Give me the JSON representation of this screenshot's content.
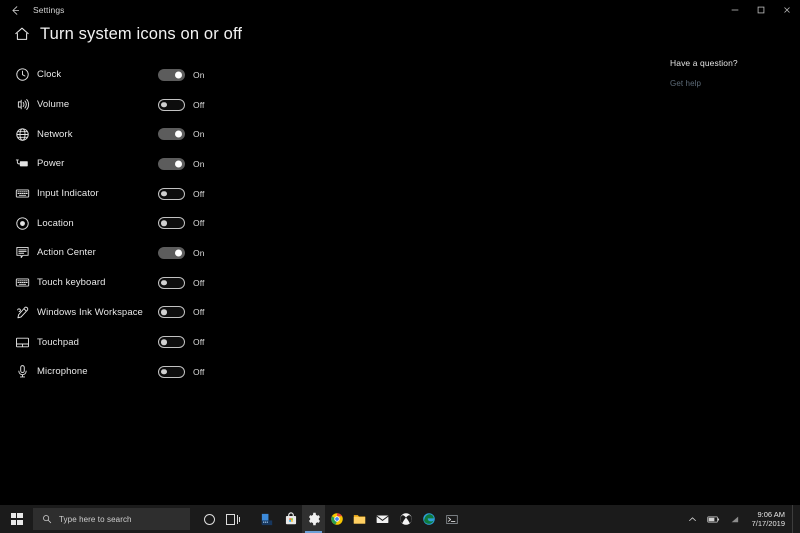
{
  "window": {
    "app_title": "Settings",
    "back_label": "←",
    "controls": {
      "minimize": "minimize-button",
      "maximize": "maximize-button",
      "close": "close-button"
    }
  },
  "header": {
    "home_icon": "home-icon",
    "title": "Turn system icons on or off"
  },
  "settings_list": [
    {
      "icon": "clock-icon",
      "label": "Clock",
      "state": "On",
      "on": true
    },
    {
      "icon": "volume-icon",
      "label": "Volume",
      "state": "Off",
      "on": false
    },
    {
      "icon": "network-globe-icon",
      "label": "Network",
      "state": "On",
      "on": true
    },
    {
      "icon": "power-battery-icon",
      "label": "Power",
      "state": "On",
      "on": true
    },
    {
      "icon": "keyboard-icon",
      "label": "Input Indicator",
      "state": "Off",
      "on": false
    },
    {
      "icon": "location-icon",
      "label": "Location",
      "state": "Off",
      "on": false
    },
    {
      "icon": "action-center-icon",
      "label": "Action Center",
      "state": "On",
      "on": true
    },
    {
      "icon": "touch-keyboard-icon",
      "label": "Touch keyboard",
      "state": "Off",
      "on": false
    },
    {
      "icon": "pen-icon",
      "label": "Windows Ink Workspace",
      "state": "Off",
      "on": false
    },
    {
      "icon": "touchpad-icon",
      "label": "Touchpad",
      "state": "Off",
      "on": false
    },
    {
      "icon": "microphone-icon",
      "label": "Microphone",
      "state": "Off",
      "on": false
    }
  ],
  "help": {
    "title": "Have a question?",
    "link": "Get help"
  },
  "taskbar": {
    "start": "windows-start-icon",
    "search_placeholder": "Type here to search",
    "cortana": "cortana-icon",
    "task_view": "task-view-icon",
    "apps": [
      {
        "name": "store-app-icon"
      },
      {
        "name": "microsoft-store-icon"
      },
      {
        "name": "settings-gear-icon",
        "active": true
      },
      {
        "name": "chrome-icon"
      },
      {
        "name": "file-explorer-icon"
      },
      {
        "name": "mail-icon"
      },
      {
        "name": "xbox-icon"
      },
      {
        "name": "edge-icon"
      },
      {
        "name": "terminal-icon"
      }
    ],
    "tray": {
      "show_hidden": "chevron-up-icon",
      "battery": "battery-icon",
      "network": "network-tray-icon",
      "time": "9:06 AM",
      "date": "7/17/2019"
    }
  },
  "colors": {
    "background": "#000000",
    "taskbar": "#1b1b1b",
    "toggle_on": "#5c5c5c",
    "toggle_border_off": "#c2c2c2",
    "link": "#5d6b78",
    "accent": "#6c9fd6"
  }
}
